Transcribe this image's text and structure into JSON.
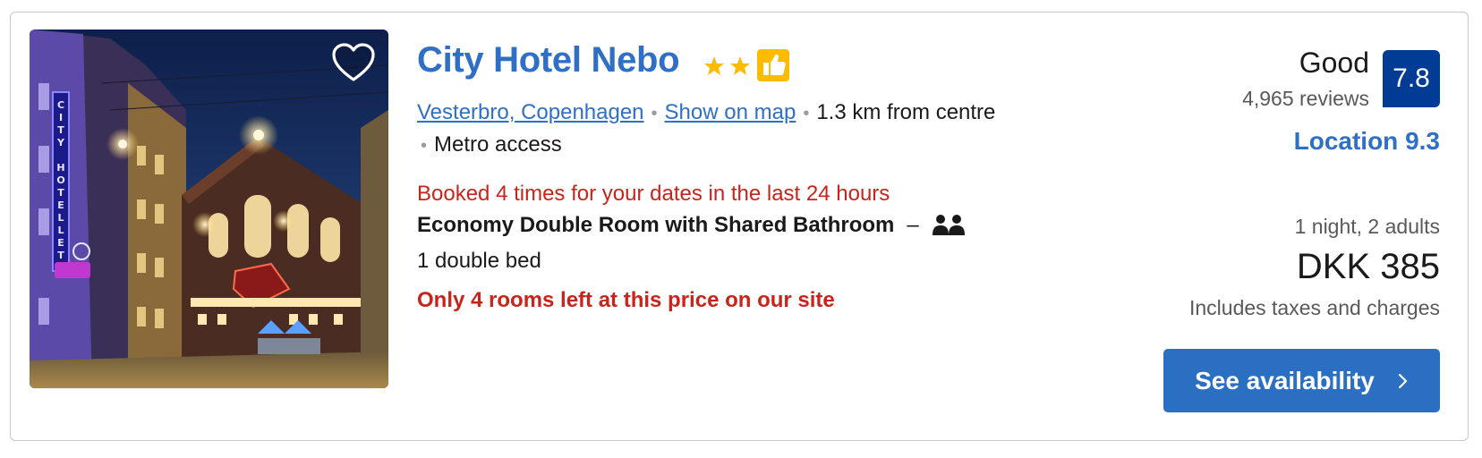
{
  "listing": {
    "hotel_name": "City Hotel Nebo",
    "star_count": 2,
    "star_color": "#febb02",
    "preferred_badge_icon": "thumbs-up-icon",
    "location_link": "Vesterbro, Copenhagen ",
    "show_on_map": " Show on map ",
    "distance": "1.3 km from centre",
    "metro": "Metro access",
    "booked_notice": "Booked 4 times for your dates in the last 24 hours",
    "room_name": "Economy Double Room with Shared Bathroom",
    "room_separator": "–",
    "occupancy_icon": "two-persons-icon",
    "bed": "1 double bed",
    "rooms_left": "Only 4 rooms left at this price on our site",
    "photo_icon": "hotel-photo",
    "favorite_icon": "heart-icon"
  },
  "review": {
    "rating_word": "Good",
    "review_count": "4,965 reviews",
    "score": "7.8",
    "score_color": "#003b95",
    "location_score": "Location 9.3"
  },
  "pricing": {
    "stay_summary": "1 night, 2 adults",
    "price": "DKK 385",
    "taxes_note": "Includes taxes and charges",
    "cta_label": "See availability",
    "cta_icon": "chevron-right-icon",
    "cta_color": "#2a6fc1"
  },
  "colors": {
    "link": "#2f6fc6",
    "urgency": "#c8241b"
  }
}
